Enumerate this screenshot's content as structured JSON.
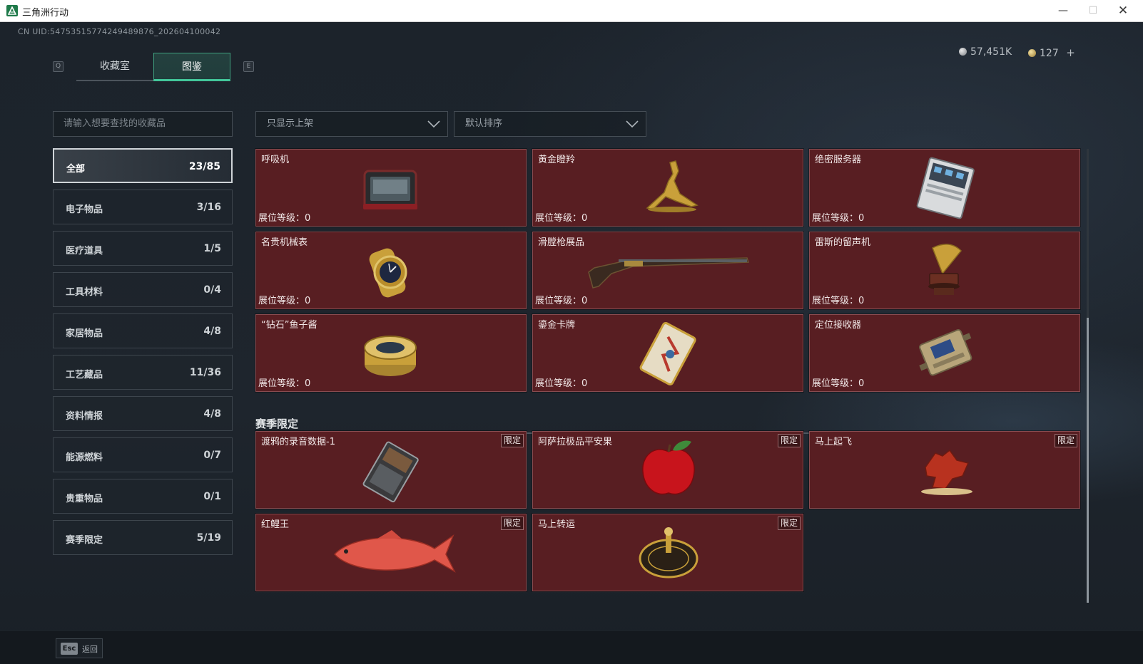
{
  "window": {
    "title": "三角洲行动",
    "min": "—",
    "max": "☐",
    "close": "✕"
  },
  "uid": "CN UID:54753515774249489876_202604100042",
  "tabs": {
    "left_key": "Q",
    "right_key": "E",
    "items": [
      {
        "label": "收藏室"
      },
      {
        "label": "图鉴"
      }
    ],
    "selected": "图鉴"
  },
  "currency": {
    "silver": "57,451K",
    "gold": "127",
    "add": "+"
  },
  "search": {
    "placeholder": "请输入想要查找的收藏品"
  },
  "categories": [
    {
      "label": "全部",
      "count": "23/85"
    },
    {
      "label": "电子物品",
      "count": "3/16"
    },
    {
      "label": "医疗道具",
      "count": "1/5"
    },
    {
      "label": "工具材料",
      "count": "0/4"
    },
    {
      "label": "家居物品",
      "count": "4/8"
    },
    {
      "label": "工艺藏品",
      "count": "11/36"
    },
    {
      "label": "资料情报",
      "count": "4/8"
    },
    {
      "label": "能源燃料",
      "count": "0/7"
    },
    {
      "label": "贵重物品",
      "count": "0/1"
    },
    {
      "label": "赛季限定",
      "count": "5/19"
    }
  ],
  "filters": {
    "shelf": "只显示上架",
    "sort": "默认排序"
  },
  "items": [
    {
      "name": "呼吸机",
      "level": "展位等级：0",
      "icon": "ventilator-icon"
    },
    {
      "name": "黄金瞪羚",
      "level": "展位等级：0",
      "icon": "golden-gazelle-icon"
    },
    {
      "name": "绝密服务器",
      "level": "展位等级：0",
      "icon": "secret-server-icon"
    },
    {
      "name": "名贵机械表",
      "level": "展位等级：0",
      "icon": "luxury-watch-icon"
    },
    {
      "name": "滑膛枪展品",
      "level": "展位等级：0",
      "icon": "musket-icon"
    },
    {
      "name": "雷斯的留声机",
      "level": "展位等级：0",
      "icon": "gramophone-icon"
    },
    {
      "name": "“钻石”鱼子酱",
      "level": "展位等级：0",
      "icon": "caviar-tin-icon"
    },
    {
      "name": "鎏金卡牌",
      "level": "展位等级：0",
      "icon": "gilded-card-icon"
    },
    {
      "name": "定位接收器",
      "level": "展位等级：0",
      "icon": "gps-receiver-icon"
    }
  ],
  "season": {
    "title": "赛季限定",
    "tag": "限定",
    "items": [
      {
        "name": "渡鸦的录音数据-1",
        "icon": "recording-device-icon"
      },
      {
        "name": "阿萨拉极品平安果",
        "icon": "apple-icon"
      },
      {
        "name": "马上起飞",
        "icon": "red-horse-icon"
      },
      {
        "name": "红鲤王",
        "icon": "red-carp-icon"
      },
      {
        "name": "马上转运",
        "icon": "golden-compass-icon"
      }
    ]
  },
  "footer": {
    "key": "Esc",
    "label": "返回"
  }
}
